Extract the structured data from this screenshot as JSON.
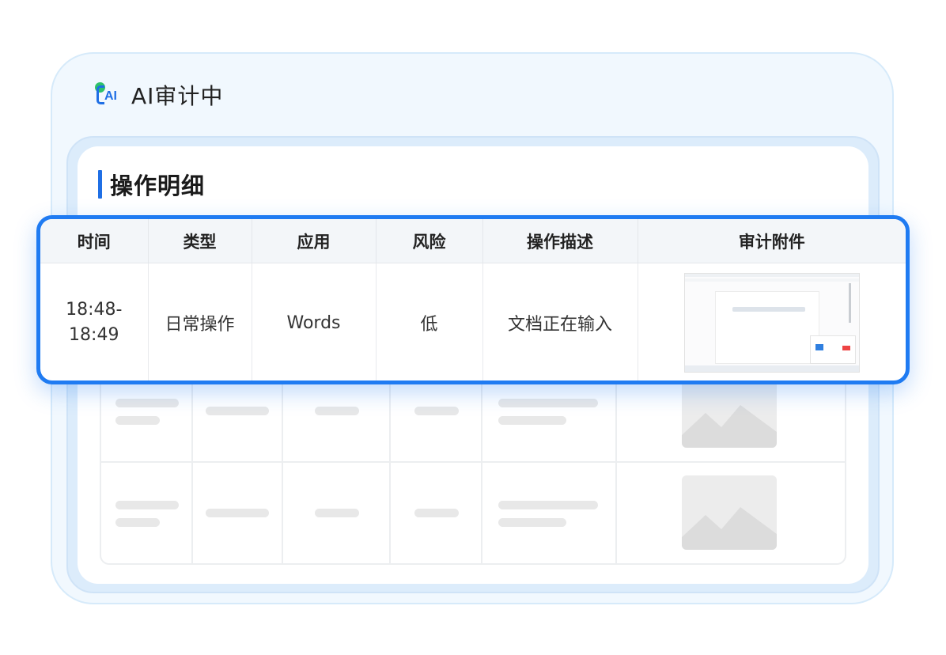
{
  "app": {
    "title": "AI审计中",
    "logo_text": "AI"
  },
  "section": {
    "title": "操作明细"
  },
  "table": {
    "headers": [
      "时间",
      "类型",
      "应用",
      "风险",
      "操作描述",
      "审计附件"
    ],
    "row": {
      "time_start": "18:48-",
      "time_end": "18:49",
      "type": "日常操作",
      "app": "Words",
      "risk": "低",
      "description": "文档正在输入"
    }
  },
  "colors": {
    "accent": "#1f7bf2",
    "logo_green": "#2ec26a",
    "background": "#f1f8fe"
  }
}
